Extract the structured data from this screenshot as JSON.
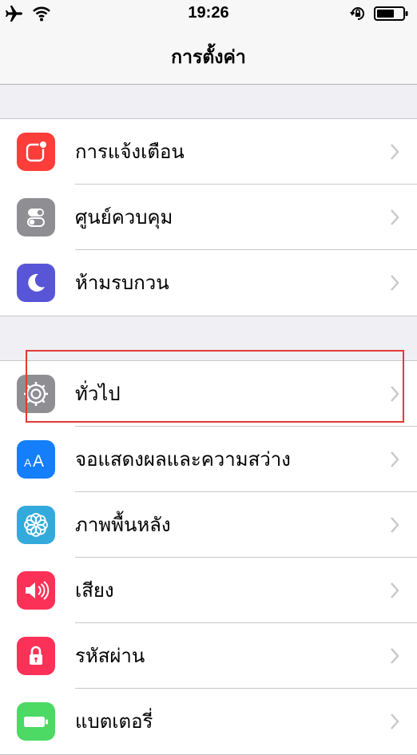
{
  "status_bar": {
    "time": "19:26",
    "icons": [
      "airplane-icon",
      "wifi-icon",
      "orientation-lock-icon",
      "battery-icon"
    ]
  },
  "nav": {
    "title": "การตั้งค่า"
  },
  "group1": [
    {
      "label": "การแจ้งเตือน",
      "icon": "notifications-icon",
      "color": "#fc3d39"
    },
    {
      "label": "ศูนย์ควบคุม",
      "icon": "control-center-icon",
      "color": "#8e8e93"
    },
    {
      "label": "ห้ามรบกวน",
      "icon": "do-not-disturb-icon",
      "color": "#5856d6"
    }
  ],
  "group2": [
    {
      "label": "ทั่วไป",
      "icon": "general-gear-icon",
      "color": "#8e8e93"
    },
    {
      "label": "จอแสดงผลและความสว่าง",
      "icon": "display-brightness-icon",
      "color": "#147efb"
    },
    {
      "label": "ภาพพื้นหลัง",
      "icon": "wallpaper-icon",
      "color": "#34aadc"
    },
    {
      "label": "เสียง",
      "icon": "sounds-icon",
      "color": "#fc3158"
    },
    {
      "label": "รหัสผ่าน",
      "icon": "passcode-lock-icon",
      "color": "#fc3158"
    },
    {
      "label": "แบตเตอรี่",
      "icon": "battery-settings-icon",
      "color": "#4cd964"
    }
  ],
  "colors": {
    "background": "#efeff4",
    "highlight": "#e53935",
    "chevron": "#c7c7cc"
  }
}
